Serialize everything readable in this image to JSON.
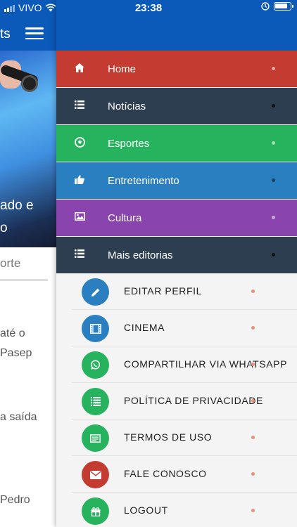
{
  "status_bar": {
    "carrier": "VIVO",
    "time": "23:38"
  },
  "background_page": {
    "title_fragment": "ts",
    "headline_line1": "ado e",
    "headline_line2": "o",
    "tab_fragment": "orte",
    "text_lines": [
      "até o",
      "Pasep",
      "a saída",
      "Pedro"
    ]
  },
  "drawer": {
    "menu": [
      {
        "label": "Home",
        "icon": "home-icon",
        "color": "#c33b31"
      },
      {
        "label": "Notícias",
        "icon": "list-icon",
        "color": "#2d3e50"
      },
      {
        "label": "Esportes",
        "icon": "soccer-ball-icon",
        "color": "#27b35e"
      },
      {
        "label": "Entretenimento",
        "icon": "thumbs-up-icon",
        "color": "#2a7fc0"
      },
      {
        "label": "Cultura",
        "icon": "image-icon",
        "color": "#8a44ad"
      },
      {
        "label": "Mais editorias",
        "icon": "list-icon",
        "color": "#2d3e50"
      }
    ],
    "submenu": [
      {
        "label": "EDITAR PERFIL",
        "icon": "pencil-icon",
        "color": "#2a7fc0"
      },
      {
        "label": "CINEMA",
        "icon": "film-icon",
        "color": "#2a7fc0"
      },
      {
        "label": "COMPARTILHAR VIA WHATSAPP",
        "icon": "whatsapp-icon",
        "color": "#27b35e"
      },
      {
        "label": "POLÍTICA DE PRIVACIDADE",
        "icon": "document-list-icon",
        "color": "#27b35e"
      },
      {
        "label": "TERMOS DE USO",
        "icon": "document-icon",
        "color": "#27b35e"
      },
      {
        "label": "FALE CONOSCO",
        "icon": "envelope-icon",
        "color": "#c33b31"
      },
      {
        "label": "LOGOUT",
        "icon": "gift-icon",
        "color": "#27b35e"
      }
    ]
  }
}
